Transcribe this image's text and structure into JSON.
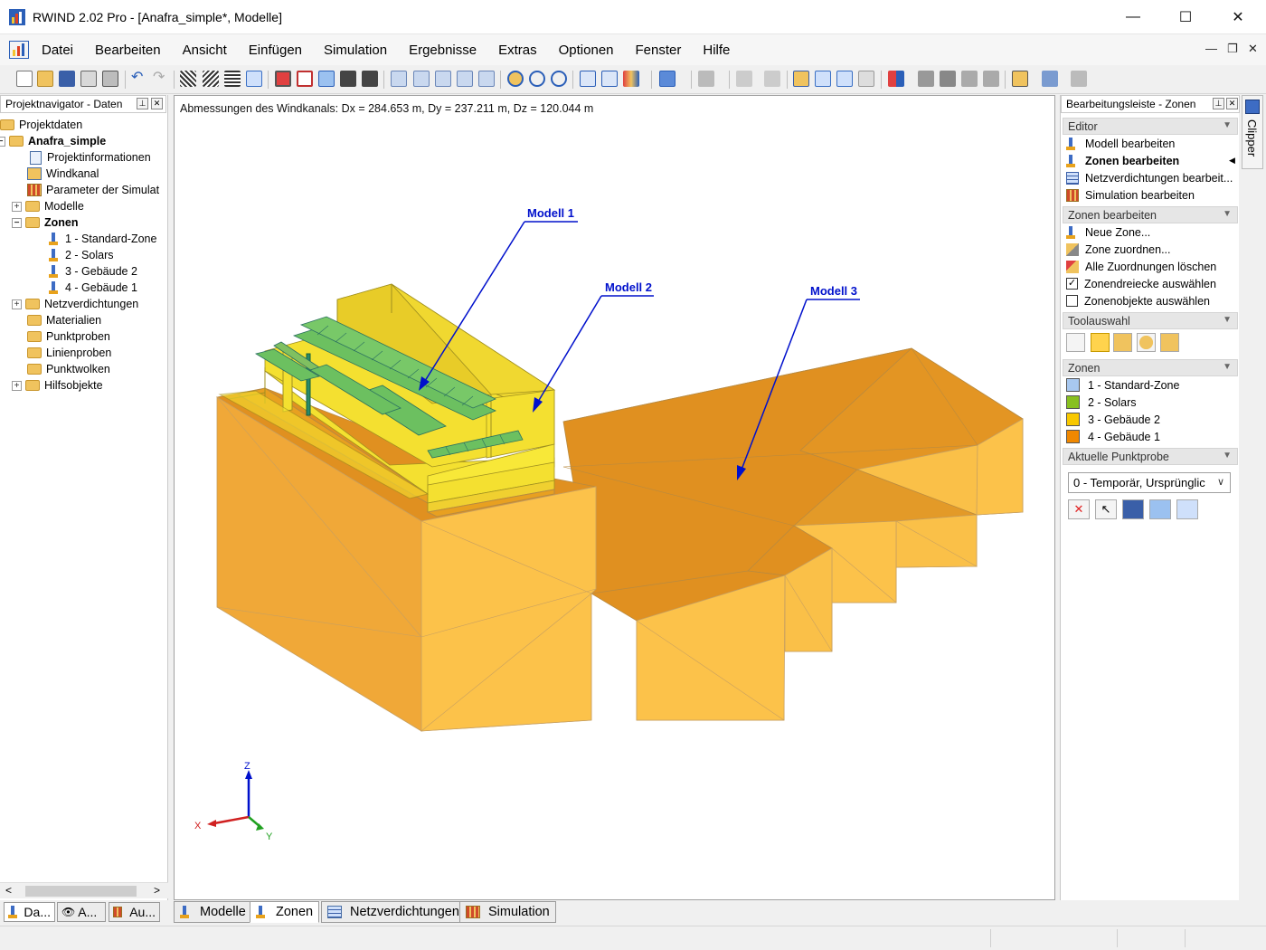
{
  "window": {
    "title": "RWIND 2.02 Pro - [Anafra_simple*, Modelle]",
    "minimize_glyph": "—",
    "maximize_glyph": "☐",
    "close_glyph": "✕"
  },
  "menu": {
    "items": [
      "Datei",
      "Bearbeiten",
      "Ansicht",
      "Einfügen",
      "Simulation",
      "Ergebnisse",
      "Extras",
      "Optionen",
      "Fenster",
      "Hilfe"
    ],
    "mdi_min": "—",
    "mdi_restore": "❐",
    "mdi_close": "✕"
  },
  "navigator": {
    "header": "Projektnavigator - Daten",
    "pin": "⊥",
    "close": "✕",
    "root": "Projektdaten",
    "project": "Anafra_simple",
    "items": {
      "projektinfo": "Projektinformationen",
      "windkanal": "Windkanal",
      "parameter": "Parameter der Simulat",
      "modelle": "Modelle",
      "zonen": "Zonen",
      "zone1": "1 - Standard-Zone",
      "zone2": "2 - Solars",
      "zone3": "3 - Gebäude 2",
      "zone4": "4 - Gebäude 1",
      "netz": "Netzverdichtungen",
      "materialien": "Materialien",
      "punktproben": "Punktproben",
      "linienproben": "Linienproben",
      "punktwolken": "Punktwolken",
      "hilfsobjekte": "Hilfsobjekte"
    },
    "tabs": [
      "Da...",
      "A...",
      "Au..."
    ],
    "scroll_left": "<",
    "scroll_right": ">"
  },
  "viewport": {
    "dimensions": "Abmessungen des Windkanals: Dx = 284.653 m, Dy = 237.211 m, Dz = 120.044 m",
    "labels": [
      "Modell 1",
      "Modell 2",
      "Modell 3"
    ],
    "axes": {
      "x": "X",
      "y": "Y",
      "z": "Z"
    }
  },
  "bottom_tabs": [
    "Modelle",
    "Zonen",
    "Netzverdichtungen",
    "Simulation"
  ],
  "right_panel": {
    "header": "Bearbeitungsleiste - Zonen",
    "editor": {
      "title": "Editor",
      "items": [
        "Modell bearbeiten",
        "Zonen bearbeiten",
        "Netzverdichtungen bearbeit...",
        "Simulation bearbeiten"
      ]
    },
    "zonen_bearbeiten": {
      "title": "Zonen bearbeiten",
      "items": [
        "Neue Zone...",
        "Zone zuordnen...",
        "Alle Zuordnungen löschen",
        "Zonendreiecke auswählen",
        "Zonenobjekte auswählen"
      ],
      "checked": [
        true,
        false
      ]
    },
    "toolauswahl": {
      "title": "Toolauswahl"
    },
    "zonen": {
      "title": "Zonen",
      "items": [
        {
          "label": "1 - Standard-Zone",
          "color": "#a8c8f0"
        },
        {
          "label": "2 - Solars",
          "color": "#88c020"
        },
        {
          "label": "3 - Gebäude 2",
          "color": "#f8c800"
        },
        {
          "label": "4 - Gebäude 1",
          "color": "#f08800"
        }
      ]
    },
    "punktprobe": {
      "title": "Aktuelle Punktprobe",
      "selected": "0 - Temporär, Ursprünglic"
    }
  },
  "clipper": {
    "label": "Clipper"
  },
  "colors": {
    "building_top": "#e09020",
    "building_side": "#fcc24a",
    "building_dark": "#f0a838",
    "yellow": "#f4e030",
    "solar": "#6cc060",
    "arrow": "#0010cc"
  }
}
